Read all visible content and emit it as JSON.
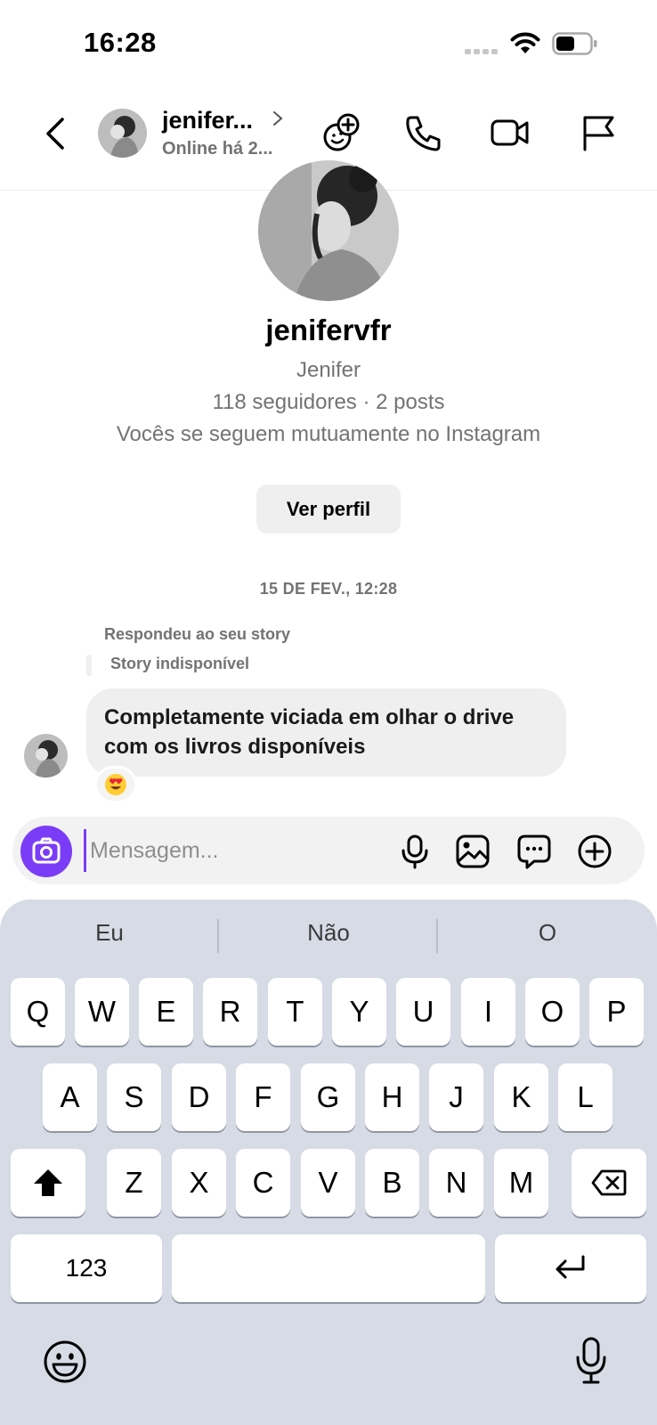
{
  "status_bar": {
    "time": "16:28",
    "icons": [
      "cellular-signal-icon",
      "wifi-icon",
      "battery-icon"
    ]
  },
  "header": {
    "back_icon": "chevron-left-icon",
    "name": "jenifer...",
    "status": "Online há 2...",
    "actions": [
      "effects-icon",
      "phone-icon",
      "video-icon",
      "flag-icon"
    ]
  },
  "profile": {
    "username": "jenifervfr",
    "full_name": "Jenifer",
    "stats": "118 seguidores · 2 posts",
    "mutual": "Vocês se seguem mutuamente no Instagram",
    "view_profile_label": "Ver perfil"
  },
  "chat": {
    "date": "15 DE FEV., 12:28",
    "reply_label": "Respondeu ao seu story",
    "story_label": "Story indisponível",
    "messages": [
      {
        "line1": "Completamente viciada em olhar o drive",
        "line2": "com os livros disponíveis",
        "reaction": "😍"
      }
    ]
  },
  "composer": {
    "placeholder": "Mensagem...",
    "icons": [
      "camera-icon",
      "microphone-icon",
      "gallery-icon",
      "sticker-icon",
      "plus-icon"
    ]
  },
  "keyboard": {
    "suggestions": [
      "Eu",
      "Não",
      "O"
    ],
    "row1": [
      "Q",
      "W",
      "E",
      "R",
      "T",
      "Y",
      "U",
      "I",
      "O",
      "P"
    ],
    "row2": [
      "A",
      "S",
      "D",
      "F",
      "G",
      "H",
      "J",
      "K",
      "L"
    ],
    "row3": [
      "Z",
      "X",
      "C",
      "V",
      "B",
      "N",
      "M"
    ],
    "numbers_label": "123",
    "accent_color": "#7b3cf7"
  }
}
